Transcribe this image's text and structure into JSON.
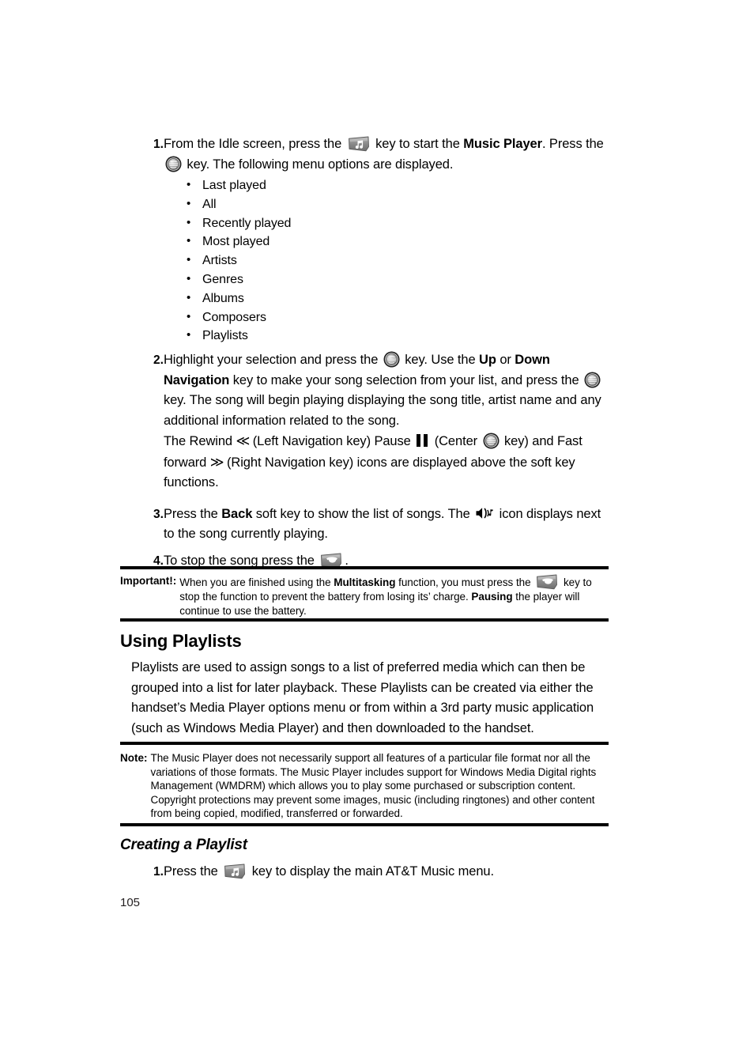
{
  "page": {
    "folio": "105"
  },
  "icons": {
    "music_key": "music-key-icon",
    "center_key": "att-center-key-icon",
    "end_key": "end-call-key-icon",
    "speaker_note": "speaker-music-note-icon",
    "pause": "pause-icon",
    "rewind": "≪",
    "fastforward": "≫"
  },
  "steps": [
    {
      "num": "1.",
      "segments": [
        {
          "t": "From the Idle screen, press the "
        },
        {
          "icon": "music_key"
        },
        {
          "t": " key to start the "
        },
        {
          "t": "Music Player",
          "b": true
        },
        {
          "t": ". Press the "
        },
        {
          "icon": "center_key"
        },
        {
          "t": " key. The following menu options are displayed."
        }
      ]
    },
    {
      "num": "2.",
      "segments": [
        {
          "t": "Highlight your selection and press the "
        },
        {
          "icon": "center_key"
        },
        {
          "t": " key. Use the "
        },
        {
          "t": "Up",
          "b": true
        },
        {
          "t": " or "
        },
        {
          "t": "Down Navigation",
          "b": true
        },
        {
          "t": " key to make your song selection from your list, and press the "
        },
        {
          "icon": "center_key"
        },
        {
          "t": " key. The song will begin playing displaying the song title, artist name and any additional information related to the song."
        }
      ]
    },
    {
      "num": "3.",
      "segments": [
        {
          "t": "Press the "
        },
        {
          "t": "Back",
          "b": true
        },
        {
          "t": " soft key to show the list of songs. The "
        },
        {
          "icon": "speaker_note"
        },
        {
          "t": " icon displays next to the song currently playing."
        }
      ]
    },
    {
      "num": "4.",
      "segments": [
        {
          "t": "To stop the song press the "
        },
        {
          "icon": "end_key"
        },
        {
          "t": "."
        }
      ]
    }
  ],
  "menu_options": [
    "Last played",
    "All",
    "Recently played",
    "Most played",
    "Artists",
    "Genres",
    "Albums",
    "Composers",
    "Playlists"
  ],
  "transport_paragraph": {
    "segments": [
      {
        "t": "The Rewind "
      },
      {
        "t": "≪",
        "chev": true
      },
      {
        "t": " (Left Navigation key) Pause "
      },
      {
        "icon": "pause"
      },
      {
        "t": " (Center "
      },
      {
        "icon": "center_key"
      },
      {
        "t": " key) and Fast forward "
      },
      {
        "t": "≫",
        "chev": true
      },
      {
        "t": " (Right Navigation key) icons are displayed above the soft key functions."
      }
    ]
  },
  "important_callout": {
    "label": "Important!:",
    "segments": [
      {
        "t": "When you are finished using the "
      },
      {
        "t": "Multitasking",
        "b": true
      },
      {
        "t": " function, you must press the "
      },
      {
        "icon": "end_key"
      },
      {
        "t": " key to stop the function to prevent the battery from losing its’ charge. "
      },
      {
        "t": "Pausing",
        "b": true
      },
      {
        "t": " the player will continue to use the battery."
      }
    ]
  },
  "using_playlists": {
    "heading": "Using Playlists",
    "body": "Playlists are used to assign songs to a list of preferred media which can then be grouped into a list for later playback. These Playlists can be created via either the handset’s Media Player options menu or from within a 3rd party music application (such as Windows Media Player) and then downloaded to the handset."
  },
  "note_callout": {
    "label": "Note:",
    "segments": [
      {
        "t": "The Music Player does not necessarily support all features of a particular file format nor all the variations of those formats. The Music Player includes support for Windows Media Digital rights Management (WMDRM) which allows you to play some purchased or subscription content. Copyright protections may prevent some images, music (including ringtones) and other content from being copied, modified, transferred or forwarded."
      }
    ]
  },
  "creating_playlist": {
    "heading": "Creating a Playlist",
    "step": {
      "num": "1.",
      "segments": [
        {
          "t": "Press the "
        },
        {
          "icon": "music_key"
        },
        {
          "t": " key to display the main AT&T Music menu."
        }
      ]
    }
  }
}
